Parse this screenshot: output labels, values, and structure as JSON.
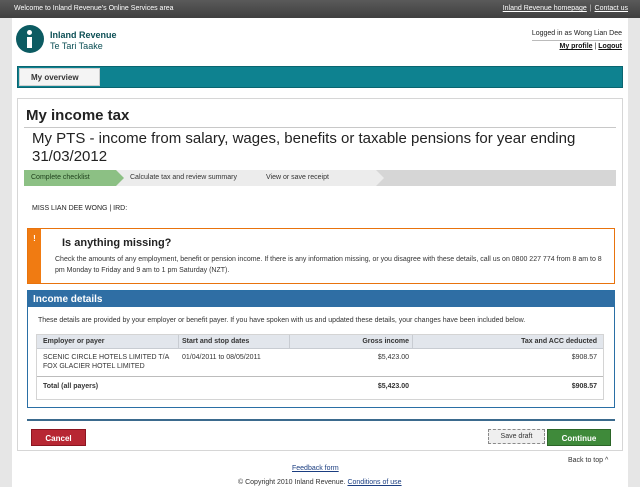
{
  "topbar": {
    "welcome": "Welcome to Inland Revenue's Online Services area",
    "homepage_link": "Inland Revenue homepage",
    "separator": "|",
    "contact_link": "Contact us"
  },
  "brand": {
    "name_en": "Inland Revenue",
    "name_mi": "Te Tari Taake",
    "logo_icon": "ird-logo-icon"
  },
  "account": {
    "logged_in": "Logged in as Wong Lian Dee",
    "profile": "My profile",
    "separator": "|",
    "logout": "Logout"
  },
  "nav": {
    "tab_overview": "My overview"
  },
  "main": {
    "section_title": "My income tax",
    "page_title": "My PTS - income from salary, wages, benefits or taxable pensions for year ending 31/03/2012",
    "steps": [
      "Complete checklist",
      "Calculate tax and review summary",
      "View or save receipt"
    ],
    "customer": "MISS LIAN DEE WONG | IRD:"
  },
  "alert": {
    "icon": "warning-icon",
    "title": "Is anything missing?",
    "body": "Check the amounts of any employment, benefit or pension income. If there is any information missing, or you disagree with these details, call us on 0800 227 774 from 8 am to 8 pm Monday to Friday and 9 am to 1 pm Saturday (NZT)."
  },
  "income": {
    "title": "Income details",
    "note": "These details are provided by your employer or benefit payer. If you have spoken with us and updated these details, your changes have been included below.",
    "columns": [
      "Employer or payer",
      "Start and stop dates",
      "Gross income",
      "Tax and ACC deducted"
    ],
    "rows": [
      {
        "employer": "SCENIC CIRCLE HOTELS LIMITED T/A FOX GLACIER HOTEL LIMITED",
        "dates": "01/04/2011 to 08/05/2011",
        "gross": "$5,423.00",
        "tax": "$908.57"
      }
    ],
    "total": {
      "label": "Total (all payers)",
      "gross": "$5,423.00",
      "tax": "$908.57"
    }
  },
  "actions": {
    "cancel": "Cancel",
    "save_draft": "Save draft",
    "continue": "Continue"
  },
  "footer": {
    "back_to_top": "Back to top ^",
    "feedback": "Feedback form",
    "copyright": "© Copyright 2010 Inland Revenue.",
    "conditions": "Conditions of use"
  },
  "colors": {
    "teal": "#0e8290",
    "blue": "#2f6ea4",
    "orange": "#f07b12",
    "red": "#b72733",
    "green": "#3f8a3a"
  }
}
